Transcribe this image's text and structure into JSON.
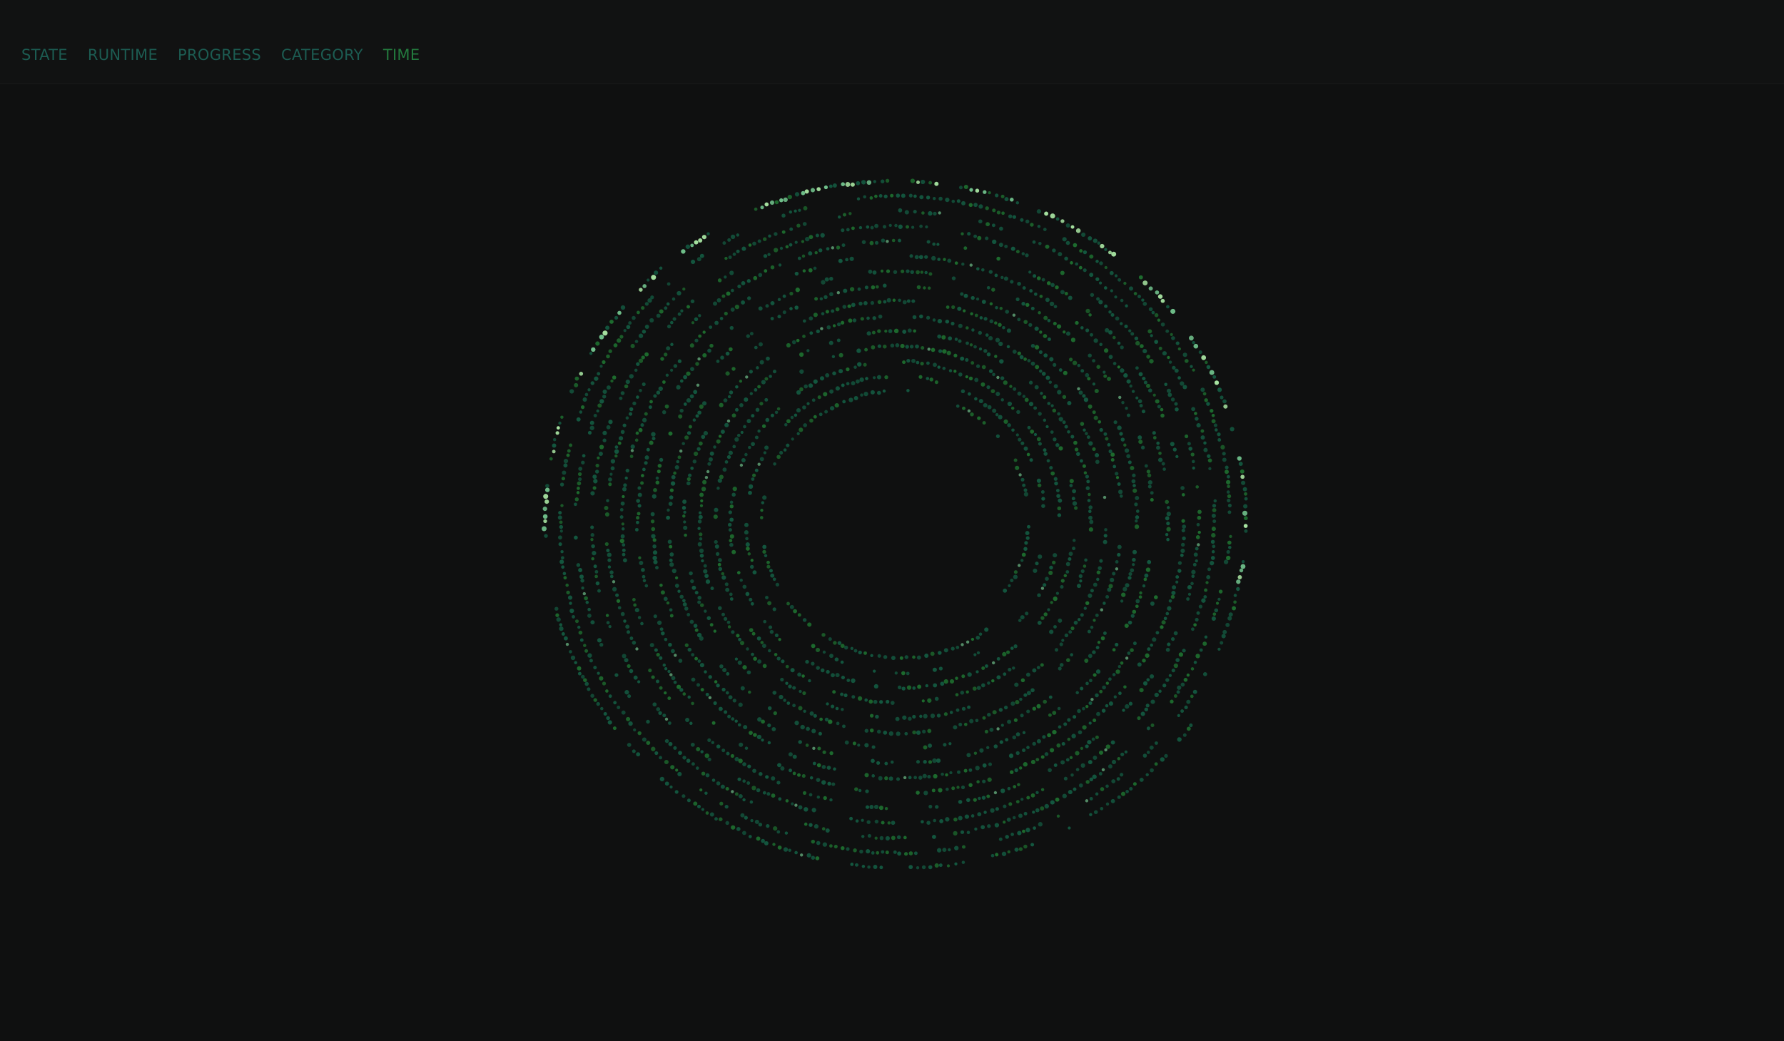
{
  "nav": {
    "tabs": [
      {
        "label": "STATE",
        "active": false
      },
      {
        "label": "RUNTIME",
        "active": false
      },
      {
        "label": "PROGRESS",
        "active": false
      },
      {
        "label": "CATEGORY",
        "active": false
      },
      {
        "label": "TIME",
        "active": true
      }
    ]
  },
  "colors": {
    "background": "#0f1010",
    "header_background": "#111212",
    "tab_text": "#1c5c52",
    "tab_active": "#237a3e",
    "dot_teal": "#13573f",
    "dot_green": "#1d6b2e",
    "dot_highlight": "#a7e3a1",
    "dot_highlight_dim": "#6fbf8a"
  },
  "visualization": {
    "type": "spiral-dot-timeline",
    "rings": 15
  }
}
